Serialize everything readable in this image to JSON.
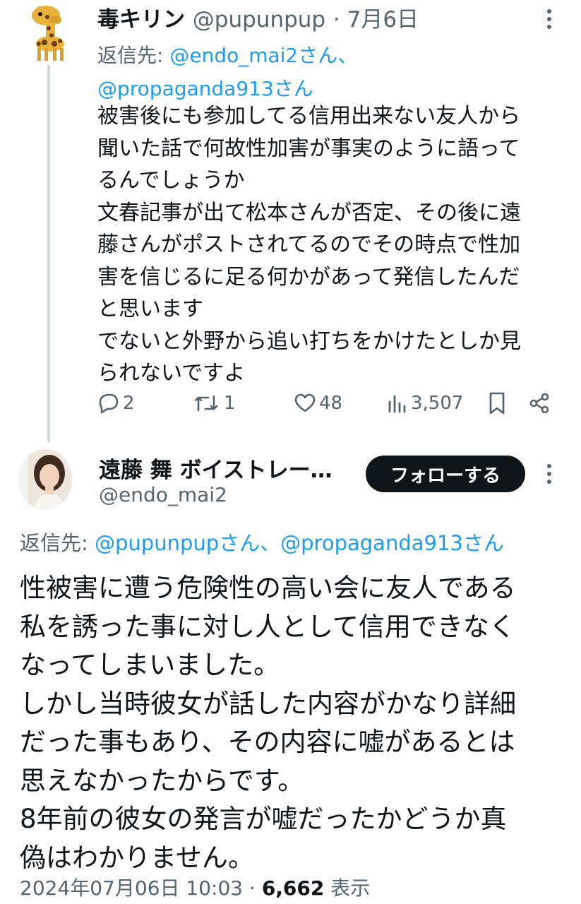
{
  "tweet1": {
    "name": "毒キリン",
    "handle": "@pupunpup",
    "date": "· 7月6日",
    "reply_prefix": "返信先: ",
    "reply_mention1": "@endo_mai2さん、",
    "reply_mention2": "@propaganda913さん",
    "body": "被害後にも参加してる信用出来ない友人から\n聞いた話で何故性加害が事実のように語って\nるんでしょうか\n文春記事が出て松本さんが否定、その後に遠\n藤さんがポストされてるのでその時点で性加\n害を信じるに足る何かがあって発信したんだ\nと思います\nでないと外野から追い打ちをかけたとしか見\nられないですよ",
    "actions": {
      "replies": "2",
      "retweets": "1",
      "likes": "48",
      "views": "3,507"
    }
  },
  "tweet2": {
    "name": "遠藤 舞 ボイストレー…",
    "handle": "@endo_mai2",
    "follow_label": "フォローする",
    "reply_prefix": "返信先: ",
    "reply_mentions": "@pupunpupさん、@propaganda913さん",
    "body": "性被害に遭う危険性の高い会に友人である\n私を誘った事に対し人として信用できなく\nなってしまいました。\nしかし当時彼女が話した内容がかなり詳細\nだった事もあり、その内容に嘘があるとは\n思えなかったからです。\n8年前の彼女の発言が嘘だったかどうか真\n偽はわかりません。",
    "timestamp": "2024年07月06日 10:03 · ",
    "views_count": "6,662",
    "views_label": " 表示"
  },
  "colors": {
    "secondary_text": "#536471",
    "link": "#1d9bf0",
    "thread_line": "#cfd9de",
    "follow_button_bg": "#0f1419"
  },
  "icons": [
    "giraffe-avatar",
    "person-avatar",
    "reply-icon",
    "retweet-icon",
    "heart-icon",
    "views-icon",
    "bookmark-icon",
    "share-icon",
    "more-icon"
  ]
}
